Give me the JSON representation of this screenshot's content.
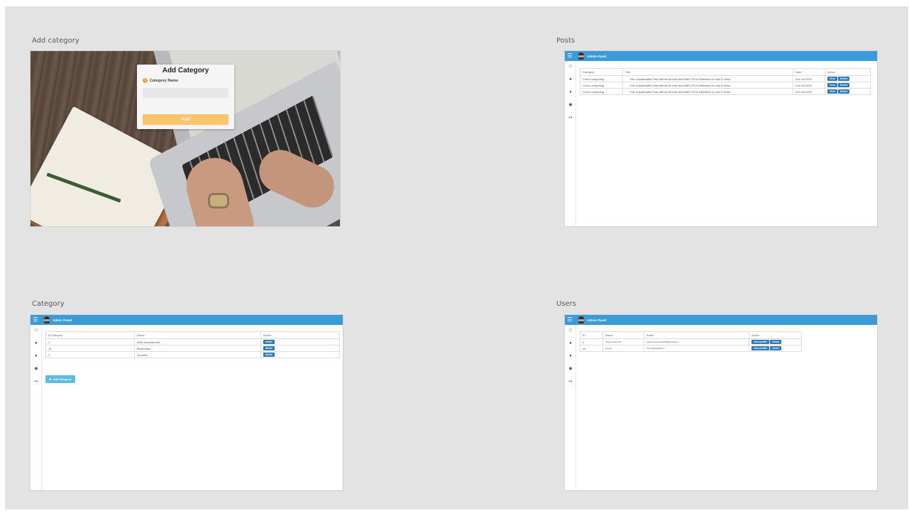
{
  "frames": {
    "add_category": {
      "label": "Add category",
      "card": {
        "title": "Add Category",
        "field_label": "Category Name",
        "field_value": "",
        "button": "Add"
      }
    },
    "posts": {
      "label": "Posts",
      "panel_title": "Admin Panel",
      "columns": [
        "Category",
        "Title",
        "Date",
        "Action"
      ],
      "rows": [
        {
          "category": "Cloud computing",
          "title": "This Unpatchable Flaw Affects All Intel and AMD CPUs Released in Last 5 Years",
          "date": "2nd Jul 2020",
          "view": "View",
          "delete": "Delete"
        },
        {
          "category": "Cloud computing",
          "title": "This Unpatchable Flaw Affects All Intel and AMD CPUs Released in Last 5 Years",
          "date": "2nd Jul 2020",
          "view": "View",
          "delete": "Delete"
        },
        {
          "category": "Cloud computing",
          "title": "This Unpatchable Flaw Affects All Intel and AMD CPUs Released in Last 5 Years",
          "date": "2nd Jul 2020",
          "view": "View",
          "delete": "Delete"
        }
      ]
    },
    "category": {
      "label": "Category",
      "panel_title": "Admin Panel",
      "columns": [
        "IDCategory",
        "Name",
        "Action"
      ],
      "rows": [
        {
          "id": "2",
          "name": "Web development",
          "action": "delete"
        },
        {
          "id": "15",
          "name": "Blockchain",
          "action": "delete"
        },
        {
          "id": "2",
          "name": "Securite",
          "action": "delete"
        }
      ],
      "add_button": "Add Category"
    },
    "users": {
      "label": "Users",
      "panel_title": "Admin Panel",
      "columns": [
        "ID",
        "Name",
        "Email",
        "Action"
      ],
      "rows": [
        {
          "id": "2",
          "name": "Yassine Elayoubi",
          "email": "yassine.elayoubi2020@gmail.com",
          "view_profile": "view profile",
          "delete": "delete"
        },
        {
          "id": "15",
          "name": "Hamza",
          "email": "hamza@gmail.com",
          "view_profile": "view profile",
          "delete": "delete"
        }
      ]
    }
  },
  "icons": {
    "menu": "hamburger-icon",
    "sidebar": [
      "monitor-icon",
      "users-icon",
      "tags-icon",
      "palette-icon",
      "logout-icon"
    ]
  },
  "colors": {
    "canvas": "#e3e3e3",
    "topbar": "#3b9ad8",
    "action_button": "#2f78b8",
    "add_button_orange": "#fcc46c",
    "add_category_button": "#5bbde4"
  }
}
